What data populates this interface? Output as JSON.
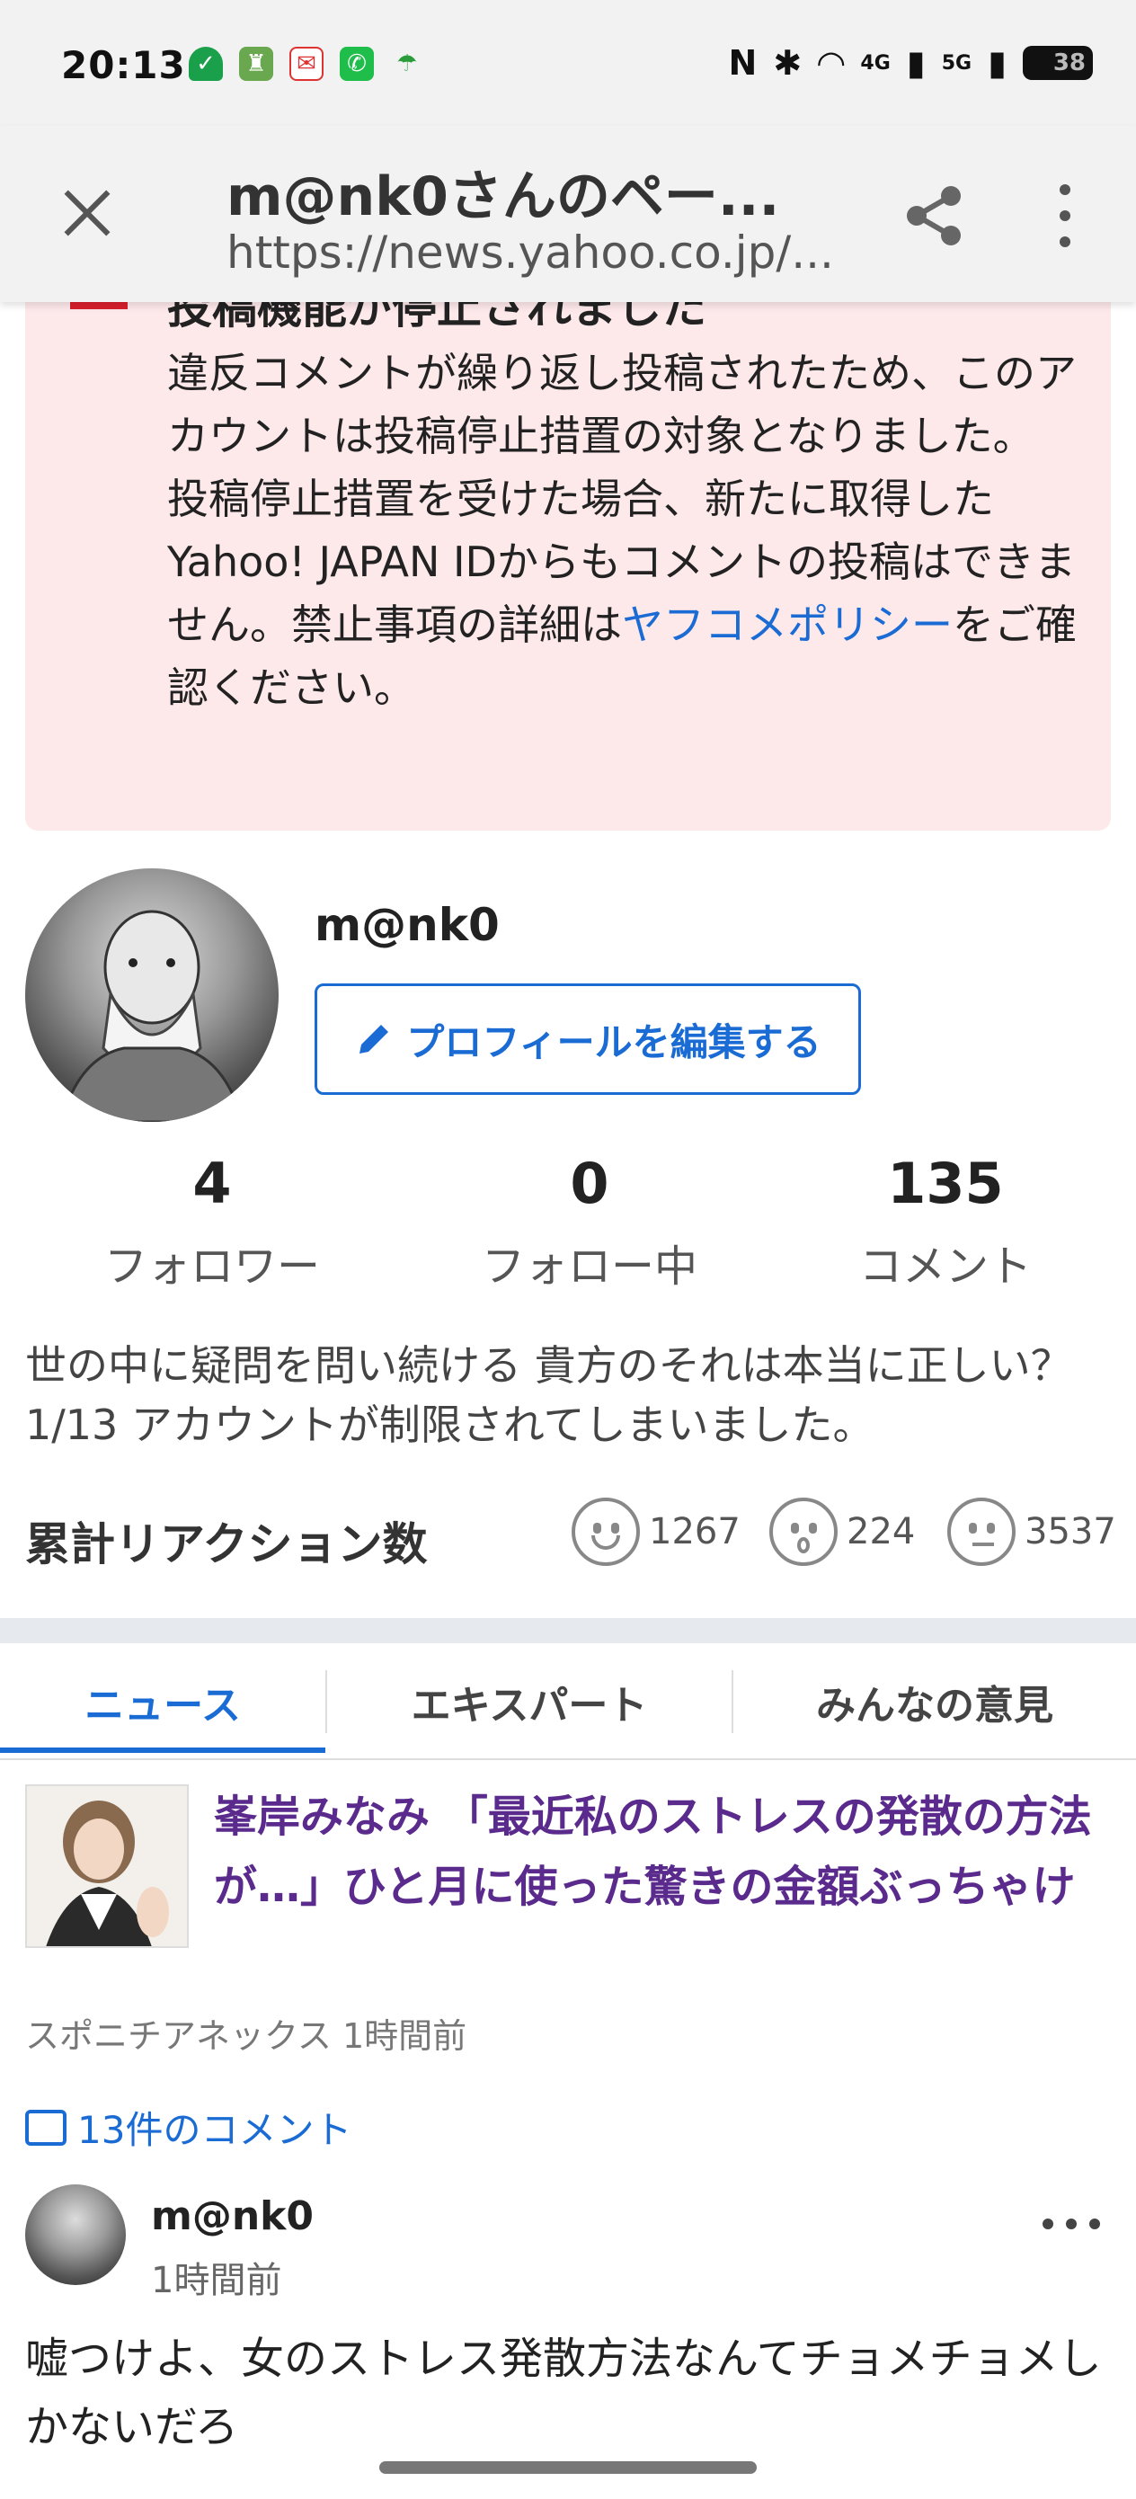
{
  "status_bar": {
    "time": "20:13",
    "network_1": "4G",
    "network_2": "5G",
    "battery": "38"
  },
  "browser": {
    "page_title": "m@nk0さんのペー...",
    "url": "https://news.yahoo.co.jp/..."
  },
  "warning": {
    "heading": "投稿機能が停止されました",
    "body_1": "違反コメントが繰り返し投稿されたため、このアカウントは投稿停止措置の対象となりました。",
    "body_2": "投稿停止措置を受けた場合、新たに取得したYahoo! JAPAN IDからもコメントの投稿はできません。禁止事項の詳細は",
    "link": "ヤフコメポリシー",
    "body_3": "をご確認ください。"
  },
  "profile": {
    "username": "m@nk0",
    "edit_label": "プロフィールを編集する",
    "stats": [
      {
        "value": "4",
        "label": "フォロワー"
      },
      {
        "value": "0",
        "label": "フォロー中"
      },
      {
        "value": "135",
        "label": "コメント"
      }
    ],
    "bio": "世の中に疑問を問い続ける 貴方のそれは本当に正しい？ 1/13 アカウントが制限されてしまいました。",
    "reaction_title": "累計リアクション数",
    "reactions": [
      {
        "icon": "smile-face-icon",
        "count": "1267"
      },
      {
        "icon": "surprised-face-icon",
        "count": "224"
      },
      {
        "icon": "thinking-face-icon",
        "count": "3537"
      }
    ]
  },
  "tabs": [
    {
      "label": "ニュース",
      "active": true
    },
    {
      "label": "エキスパート",
      "active": false
    },
    {
      "label": "みんなの意見",
      "active": false
    }
  ],
  "article": {
    "title": "峯岸みなみ 「最近私のストレスの発散の方法が…」ひと月に使った驚きの金額ぶっちゃけ",
    "meta": "スポニチアネックス 1時間前",
    "comments_link": "13件のコメント"
  },
  "comment": {
    "username": "m@nk0",
    "time": "1時間前",
    "body": "嘘つけよ、女のストレス発散方法なんてチョメチョメしかないだろ"
  },
  "colors": {
    "accent": "#1a6cd4",
    "warning_bg": "#fde8ea",
    "warning_icon": "#d81e2c",
    "visited_link": "#5a2a8c"
  }
}
